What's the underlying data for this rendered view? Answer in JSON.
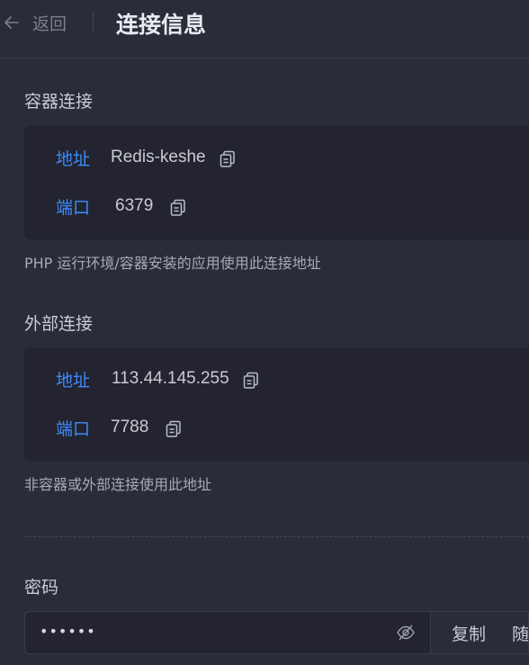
{
  "header": {
    "back_label": "返回",
    "title": "连接信息"
  },
  "container_connection": {
    "title": "容器连接",
    "address_label": "地址",
    "address_value": "Redis-keshe",
    "port_label": "端口",
    "port_value": "6379",
    "hint": "PHP 运行环境/容器安装的应用使用此连接地址"
  },
  "external_connection": {
    "title": "外部连接",
    "address_label": "地址",
    "address_value": "113.44.145.255",
    "port_label": "端口",
    "port_value": "7788",
    "hint": "非容器或外部连接使用此地址"
  },
  "password": {
    "label": "密码",
    "masked_value": "••••••",
    "copy_label": "复制",
    "random_label": "随"
  },
  "icons": {
    "back": "arrow-left-icon",
    "copy": "copy-icon",
    "visibility": "eye-off-icon"
  },
  "colors": {
    "background": "#2b2c3a",
    "card": "#23242f",
    "accent": "#3d8bff",
    "text": "#c9cad4"
  }
}
